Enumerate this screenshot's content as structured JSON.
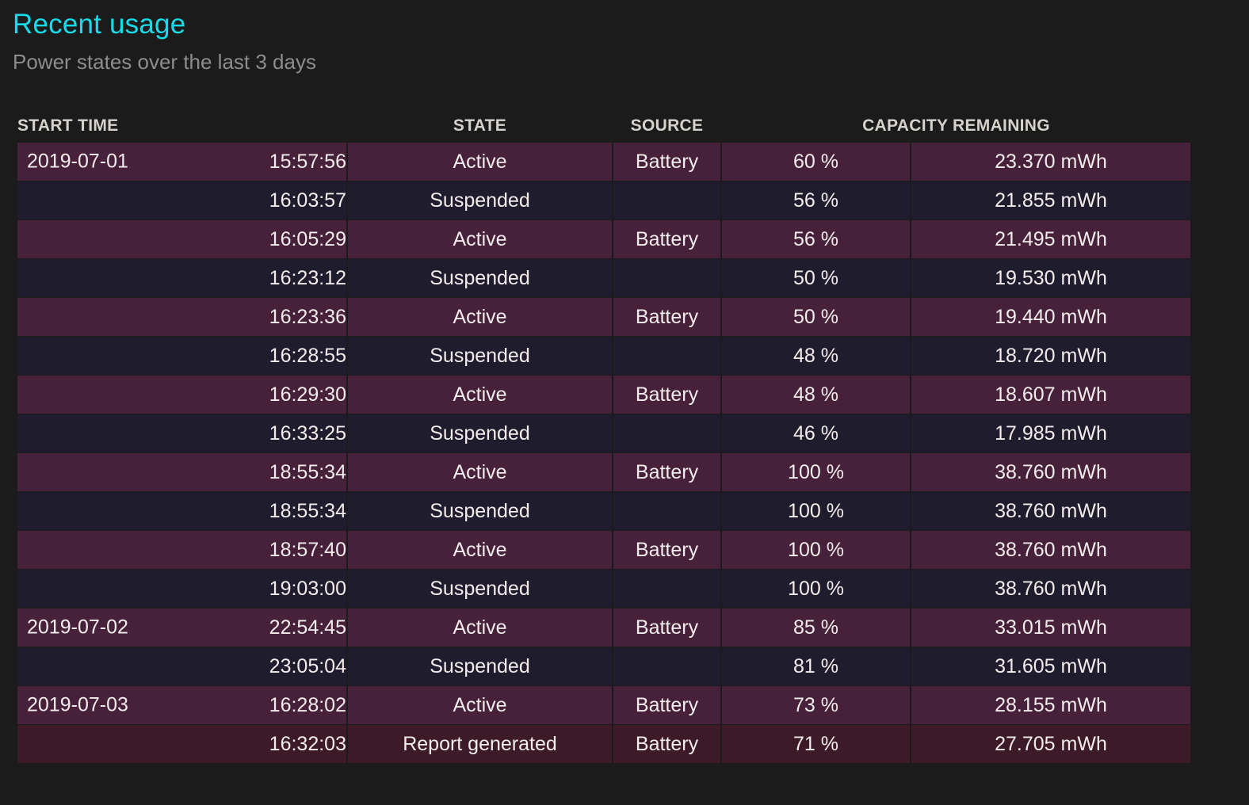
{
  "header": {
    "title": "Recent usage",
    "subtitle": "Power states over the last 3 days"
  },
  "colors": {
    "page_background": "#1b1b1b",
    "title_accent": "#16dbe8",
    "subtitle": "#8d8d8d",
    "header_text": "#d6d2cd",
    "row_active": "#47203a",
    "row_suspended": "#1f1c2e",
    "row_report": "#3d1a28",
    "cell_text": "#f2ecec"
  },
  "table": {
    "columns": [
      {
        "key": "start_time",
        "label": "START TIME",
        "align": "left"
      },
      {
        "key": "state",
        "label": "STATE",
        "align": "center"
      },
      {
        "key": "source",
        "label": "SOURCE",
        "align": "center"
      },
      {
        "key": "capacity_remaining",
        "label": "CAPACITY REMAINING",
        "align": "center"
      }
    ],
    "rows": [
      {
        "date": "2019-07-01",
        "time": "15:57:56",
        "state": "Active",
        "source": "Battery",
        "percent": "60 %",
        "mwh": "23.370 mWh",
        "row_type": "active"
      },
      {
        "date": "",
        "time": "16:03:57",
        "state": "Suspended",
        "source": "",
        "percent": "56 %",
        "mwh": "21.855 mWh",
        "row_type": "suspended"
      },
      {
        "date": "",
        "time": "16:05:29",
        "state": "Active",
        "source": "Battery",
        "percent": "56 %",
        "mwh": "21.495 mWh",
        "row_type": "active"
      },
      {
        "date": "",
        "time": "16:23:12",
        "state": "Suspended",
        "source": "",
        "percent": "50 %",
        "mwh": "19.530 mWh",
        "row_type": "suspended"
      },
      {
        "date": "",
        "time": "16:23:36",
        "state": "Active",
        "source": "Battery",
        "percent": "50 %",
        "mwh": "19.440 mWh",
        "row_type": "active"
      },
      {
        "date": "",
        "time": "16:28:55",
        "state": "Suspended",
        "source": "",
        "percent": "48 %",
        "mwh": "18.720 mWh",
        "row_type": "suspended"
      },
      {
        "date": "",
        "time": "16:29:30",
        "state": "Active",
        "source": "Battery",
        "percent": "48 %",
        "mwh": "18.607 mWh",
        "row_type": "active"
      },
      {
        "date": "",
        "time": "16:33:25",
        "state": "Suspended",
        "source": "",
        "percent": "46 %",
        "mwh": "17.985 mWh",
        "row_type": "suspended"
      },
      {
        "date": "",
        "time": "18:55:34",
        "state": "Active",
        "source": "Battery",
        "percent": "100 %",
        "mwh": "38.760 mWh",
        "row_type": "active"
      },
      {
        "date": "",
        "time": "18:55:34",
        "state": "Suspended",
        "source": "",
        "percent": "100 %",
        "mwh": "38.760 mWh",
        "row_type": "suspended"
      },
      {
        "date": "",
        "time": "18:57:40",
        "state": "Active",
        "source": "Battery",
        "percent": "100 %",
        "mwh": "38.760 mWh",
        "row_type": "active"
      },
      {
        "date": "",
        "time": "19:03:00",
        "state": "Suspended",
        "source": "",
        "percent": "100 %",
        "mwh": "38.760 mWh",
        "row_type": "suspended"
      },
      {
        "date": "2019-07-02",
        "time": "22:54:45",
        "state": "Active",
        "source": "Battery",
        "percent": "85 %",
        "mwh": "33.015 mWh",
        "row_type": "active"
      },
      {
        "date": "",
        "time": "23:05:04",
        "state": "Suspended",
        "source": "",
        "percent": "81 %",
        "mwh": "31.605 mWh",
        "row_type": "suspended"
      },
      {
        "date": "2019-07-03",
        "time": "16:28:02",
        "state": "Active",
        "source": "Battery",
        "percent": "73 %",
        "mwh": "28.155 mWh",
        "row_type": "active"
      },
      {
        "date": "",
        "time": "16:32:03",
        "state": "Report generated",
        "source": "Battery",
        "percent": "71 %",
        "mwh": "27.705 mWh",
        "row_type": "report"
      }
    ]
  }
}
